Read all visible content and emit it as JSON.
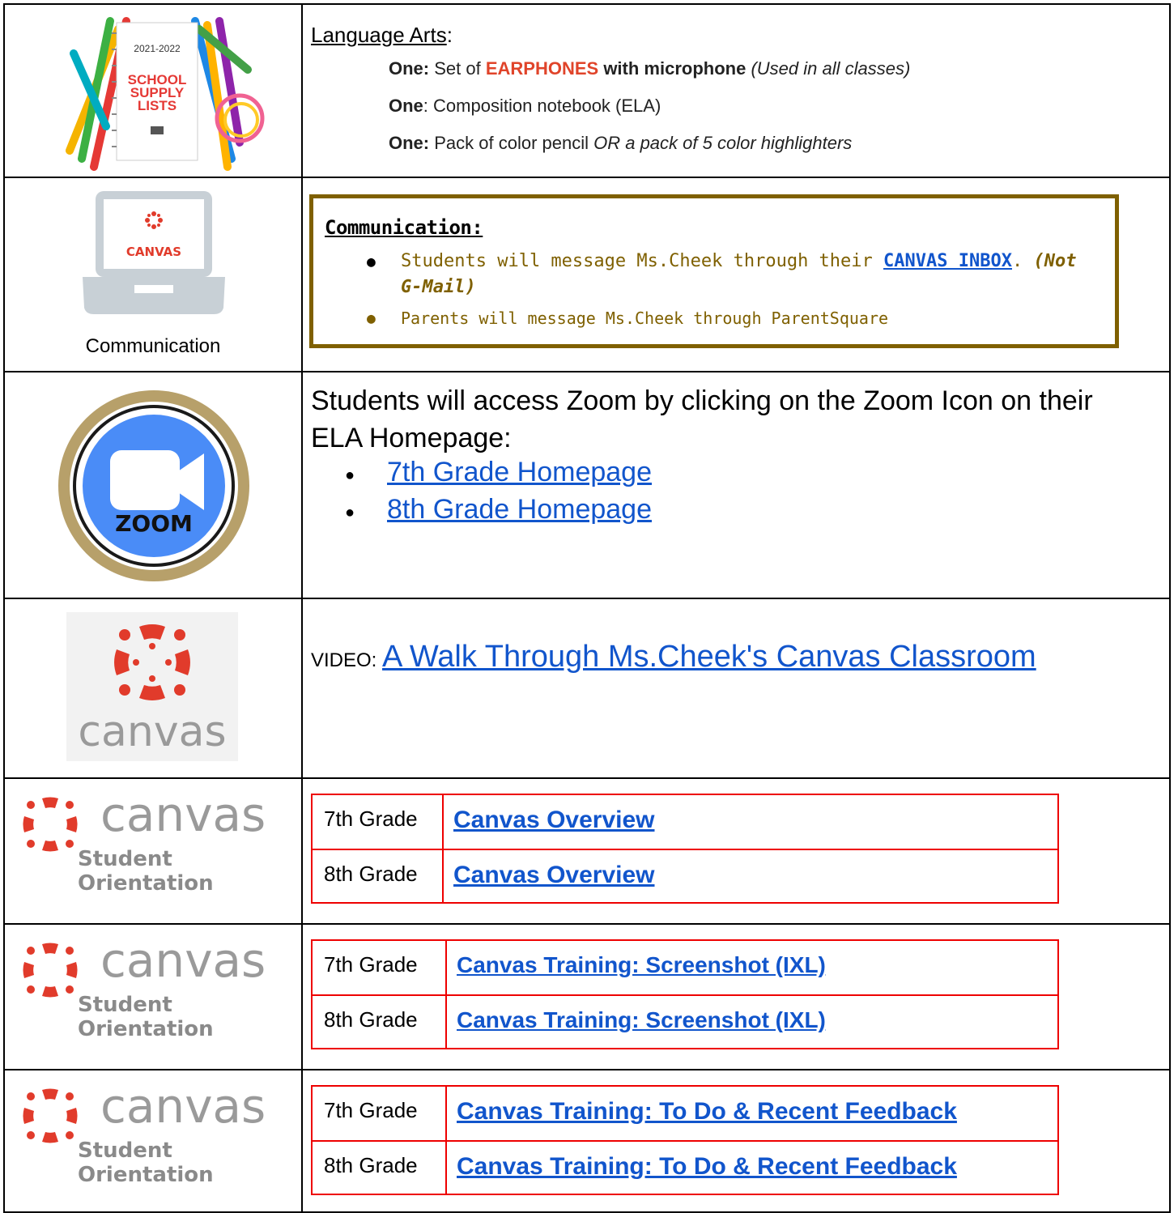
{
  "row1": {
    "image_alt": "school supply lists notebook",
    "notebook_year": "2021-2022",
    "notebook_title_1": "SCHOOL",
    "notebook_title_2": "SUPPLY",
    "notebook_title_3": "LISTS",
    "heading": "Language Arts",
    "heading_suffix": ":",
    "items": [
      {
        "lead": "One:",
        "t1": " Set of ",
        "em": "EARPHONES",
        "t2": " with microphone",
        "tail": " (Used in all classes)"
      },
      {
        "lead": "One",
        "t1": ": Composition notebook (ELA)"
      },
      {
        "lead": "One:",
        "t1": " Pack of color pencil ",
        "tail": "OR a pack of 5 color highlighters"
      }
    ]
  },
  "row2": {
    "screen_label": "CANVAS",
    "caption": "Communication",
    "title": "Communication:",
    "item1_pre": "Students will message Ms.Cheek through their ",
    "item1_link": "CANVAS INBOX",
    "item1_post": ".  ",
    "item1_note": "(Not",
    "item1_note2": "G-Mail)",
    "item2": "Parents will message Ms.Cheek through ParentSquare"
  },
  "row3": {
    "logo_text": "ZOOM",
    "line1": "Students will access Zoom by clicking on the Zoom Icon on their",
    "line2": "ELA Homepage:",
    "links": [
      "7th Grade Homepage",
      "8th Grade Homepage"
    ]
  },
  "row4": {
    "logo_word": "canvas",
    "prefix": "VIDEO: ",
    "link": "A Walk Through Ms.Cheek's Canvas Classroom"
  },
  "orient": {
    "word": "canvas",
    "sub": "Student Orientation"
  },
  "tables": [
    {
      "rows": [
        {
          "grade": "7th Grade",
          "link": "Canvas Overview"
        },
        {
          "grade": "8th Grade",
          "link": "Canvas Overview"
        }
      ]
    },
    {
      "rows": [
        {
          "grade": "7th Grade",
          "link": "Canvas Training: Screenshot (IXL)"
        },
        {
          "grade": "8th Grade",
          "link": "Canvas Training: Screenshot (IXL)"
        }
      ]
    },
    {
      "rows": [
        {
          "grade": "7th Grade",
          "link": "Canvas Training: To Do & Recent Feedback"
        },
        {
          "grade": "8th Grade",
          "link": "Canvas Training: To Do & Recent Feedback"
        }
      ]
    }
  ],
  "colors": {
    "canvas_red": "#e13b2b",
    "comm_border": "#7f6000",
    "link": "#1155cc",
    "zoom_blue": "#4a8cf7",
    "zoom_gold": "#b7a06a"
  }
}
